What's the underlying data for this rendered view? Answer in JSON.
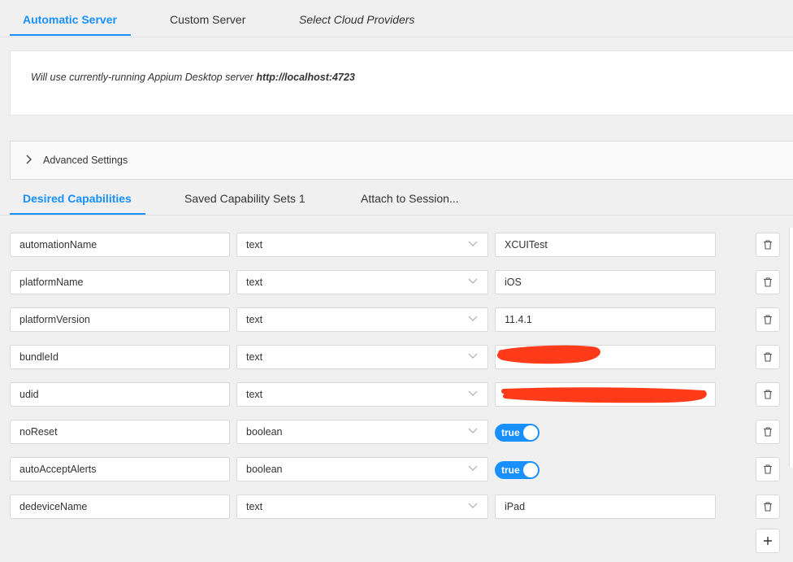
{
  "server_tabs": [
    {
      "label": "Automatic Server",
      "active": true
    },
    {
      "label": "Custom Server",
      "active": false
    },
    {
      "label": "Select Cloud Providers",
      "active": false
    }
  ],
  "server_info": {
    "prefix": "Will use currently-running Appium Desktop server ",
    "url": "http://localhost:4723"
  },
  "advanced": {
    "label": "Advanced Settings"
  },
  "capability_tabs": [
    {
      "label": "Desired Capabilities",
      "active": true
    },
    {
      "label": "Saved Capability Sets 1",
      "active": false
    },
    {
      "label": "Attach to Session...",
      "active": false
    }
  ],
  "capabilities": [
    {
      "name": "automationName",
      "type": "text",
      "value": "XCUITest"
    },
    {
      "name": "platformName",
      "type": "text",
      "value": "iOS"
    },
    {
      "name": "platformVersion",
      "type": "text",
      "value": "11.4.1"
    },
    {
      "name": "bundleId",
      "type": "text",
      "value": ""
    },
    {
      "name": "udid",
      "type": "text",
      "value": ""
    },
    {
      "name": "noReset",
      "type": "boolean",
      "value": "true"
    },
    {
      "name": "autoAcceptAlerts",
      "type": "boolean",
      "value": "true"
    },
    {
      "name": "dedeviceName",
      "type": "text",
      "value": "iPad"
    }
  ],
  "colors": {
    "accent": "#1890ff",
    "redaction": "#ff3b1a"
  },
  "icons": {
    "expand": "chevron-right-icon",
    "select": "chevron-down-icon",
    "delete": "trash-icon",
    "add": "plus-icon"
  }
}
